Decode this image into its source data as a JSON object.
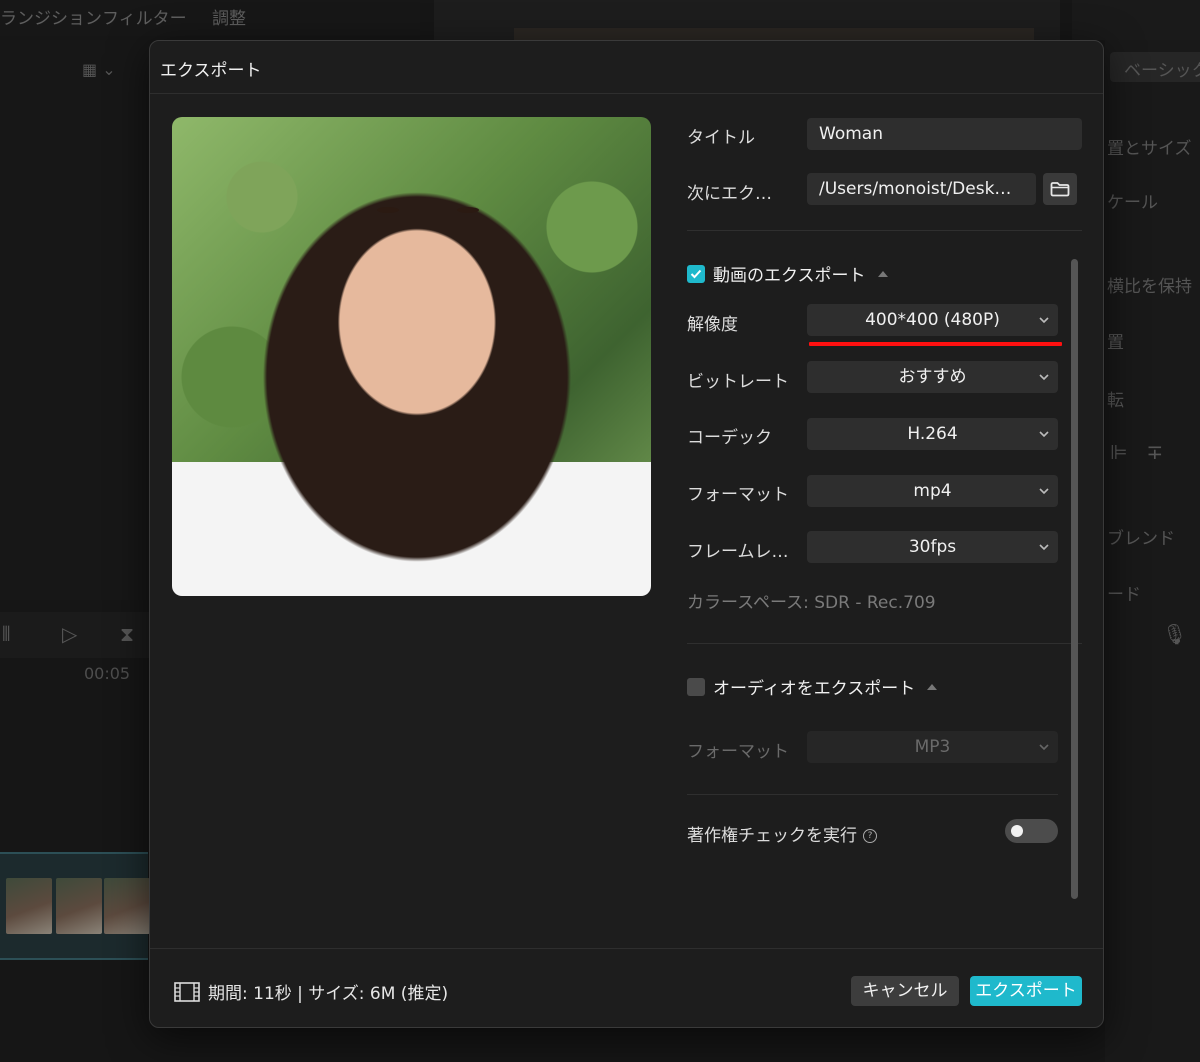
{
  "background": {
    "menu": [
      "ランジション",
      "フィルター",
      "調整"
    ],
    "right_tab": "ベーシック",
    "right_items": [
      "置とサイズ",
      "ケール",
      "横比を保持",
      "置",
      "転",
      "ブレンド",
      "ード"
    ],
    "timecode": "00:05"
  },
  "dialog": {
    "title": "エクスポート",
    "fields": {
      "title_label": "タイトル",
      "title_value": "Woman",
      "export_to_label": "次にエク…",
      "export_to_value": "/Users/monoist/Desk…"
    },
    "video_section": {
      "label": "動画のエクスポート",
      "checked": true,
      "resolution_label": "解像度",
      "resolution_value": "400*400 (480P)",
      "bitrate_label": "ビットレート",
      "bitrate_value": "おすすめ",
      "codec_label": "コーデック",
      "codec_value": "H.264",
      "format_label": "フォーマット",
      "format_value": "mp4",
      "framerate_label": "フレームレ…",
      "framerate_value": "30fps",
      "colorspace": "カラースペース: SDR - Rec.709"
    },
    "audio_section": {
      "label": "オーディオをエクスポート",
      "checked": false,
      "format_label": "フォーマット",
      "format_value": "MP3"
    },
    "copyright_label": "著作権チェックを実行",
    "copyright_enabled": false,
    "footer": {
      "info": "期間: 11秒 | サイズ: 6M (推定)",
      "cancel_label": "キャンセル",
      "export_label": "エクスポート"
    }
  },
  "colors": {
    "accent": "#1fb9cc",
    "highlight_underline": "#ff1010",
    "dialog_bg": "#1d1d1d",
    "field_bg": "#2e2e2e"
  }
}
